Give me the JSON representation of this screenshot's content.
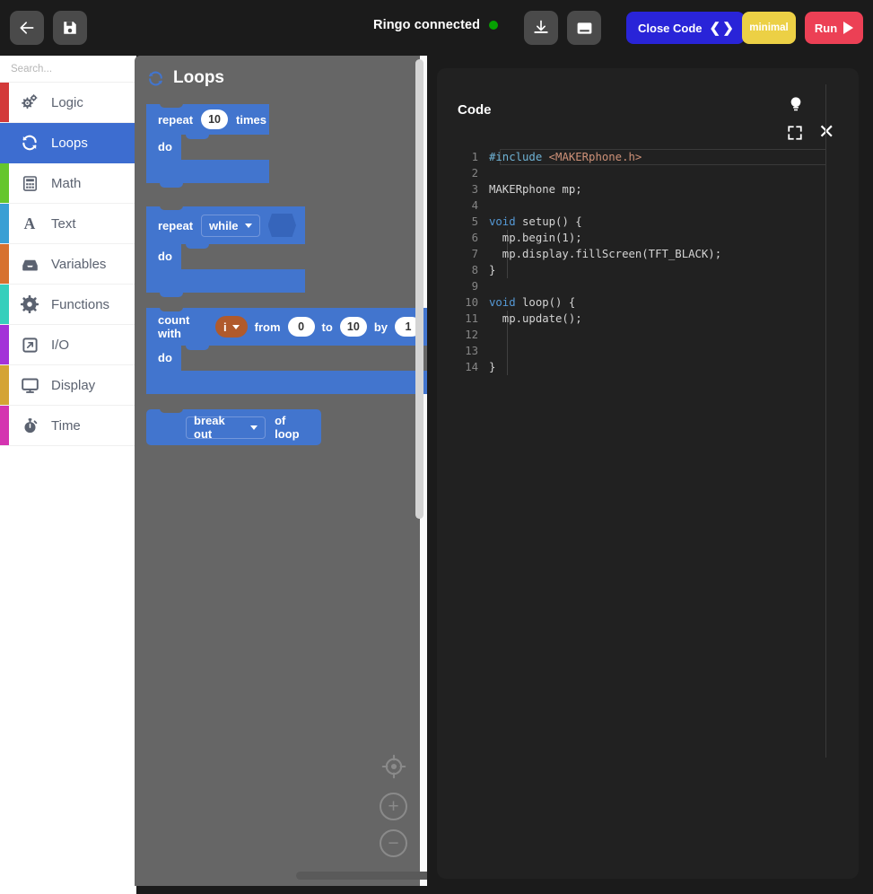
{
  "header": {
    "back_icon": "arrow-left-icon",
    "save_icon": "floppy-disk-icon",
    "status_text": "Ringo connected",
    "status_color": "#06a102",
    "download_icon": "download-icon",
    "console_icon": "console-panel-icon",
    "close_code_label": "Close Code",
    "close_code_chevrons": "❮ ❯",
    "close_code_color": "#2924d8",
    "minimal_label": "minimal",
    "minimal_color": "#ecd045",
    "run_label": "Run",
    "run_color": "#ec4055"
  },
  "sidebar": {
    "search_placeholder": "Search...",
    "search_value": "",
    "categories": [
      {
        "label": "Logic",
        "color": "#d33a3a",
        "icon": "gears-icon",
        "active": false
      },
      {
        "label": "Loops",
        "color": "#3d6dd0",
        "icon": "loop-refresh-icon",
        "active": true
      },
      {
        "label": "Math",
        "color": "#65c62c",
        "icon": "calculator-icon",
        "active": false
      },
      {
        "label": "Text",
        "color": "#3a9fd4",
        "icon": "letter-a-icon",
        "active": false
      },
      {
        "label": "Variables",
        "color": "#d7712f",
        "icon": "inbox-tray-icon",
        "active": false
      },
      {
        "label": "Functions",
        "color": "#36cfbc",
        "icon": "gear-icon",
        "active": false
      },
      {
        "label": "I/O",
        "color": "#a332d8",
        "icon": "arrow-out-icon",
        "active": false
      },
      {
        "label": "Display",
        "color": "#d4a434",
        "icon": "monitor-icon",
        "active": false
      },
      {
        "label": "Time",
        "color": "#d434b0",
        "icon": "stopwatch-icon",
        "active": false
      }
    ]
  },
  "flyout": {
    "title": "Loops",
    "title_icon": "loop-refresh-icon",
    "blocks": [
      {
        "id": "repeat-times",
        "words": {
          "w1": "repeat",
          "w2": "times",
          "do": "do"
        },
        "value": "10"
      },
      {
        "id": "repeat-while",
        "words": {
          "w1": "repeat",
          "do": "do"
        },
        "dropdown": "while"
      },
      {
        "id": "count-with",
        "words": {
          "w1": "count with",
          "w2": "from",
          "w3": "to",
          "w4": "by",
          "do": "do"
        },
        "variable": "i",
        "from": "0",
        "to": "10",
        "by": "1"
      },
      {
        "id": "break-out",
        "dropdown": "break out",
        "words": {
          "w1": "of loop"
        }
      }
    ],
    "zoom_controls": [
      {
        "icon": "center-target-icon",
        "label": ""
      },
      {
        "icon": "zoom-in-icon",
        "label": "+"
      },
      {
        "icon": "zoom-out-icon",
        "label": "−"
      }
    ]
  },
  "code_panel": {
    "title": "Code",
    "bulb_icon": "lightbulb-icon",
    "expand_icon": "fullscreen-expand-icon",
    "close_icon": "close-x-icon",
    "lines": [
      {
        "n": "1",
        "text": "#include <MAKERphone.h>",
        "type": "include"
      },
      {
        "n": "2",
        "text": "",
        "type": "blank"
      },
      {
        "n": "3",
        "text": "MAKERphone mp;",
        "type": "plain"
      },
      {
        "n": "4",
        "text": "",
        "type": "blank"
      },
      {
        "n": "5",
        "text": "void setup() {",
        "type": "kw-decl"
      },
      {
        "n": "6",
        "text": "  mp.begin(1);",
        "type": "plain"
      },
      {
        "n": "7",
        "text": "  mp.display.fillScreen(TFT_BLACK);",
        "type": "plain"
      },
      {
        "n": "8",
        "text": "}",
        "type": "plain"
      },
      {
        "n": "9",
        "text": "",
        "type": "blank"
      },
      {
        "n": "10",
        "text": "void loop() {",
        "type": "kw-decl"
      },
      {
        "n": "11",
        "text": "  mp.update();",
        "type": "plain"
      },
      {
        "n": "12",
        "text": "",
        "type": "blank"
      },
      {
        "n": "13",
        "text": "",
        "type": "blank"
      },
      {
        "n": "14",
        "text": "}",
        "type": "plain"
      }
    ]
  }
}
